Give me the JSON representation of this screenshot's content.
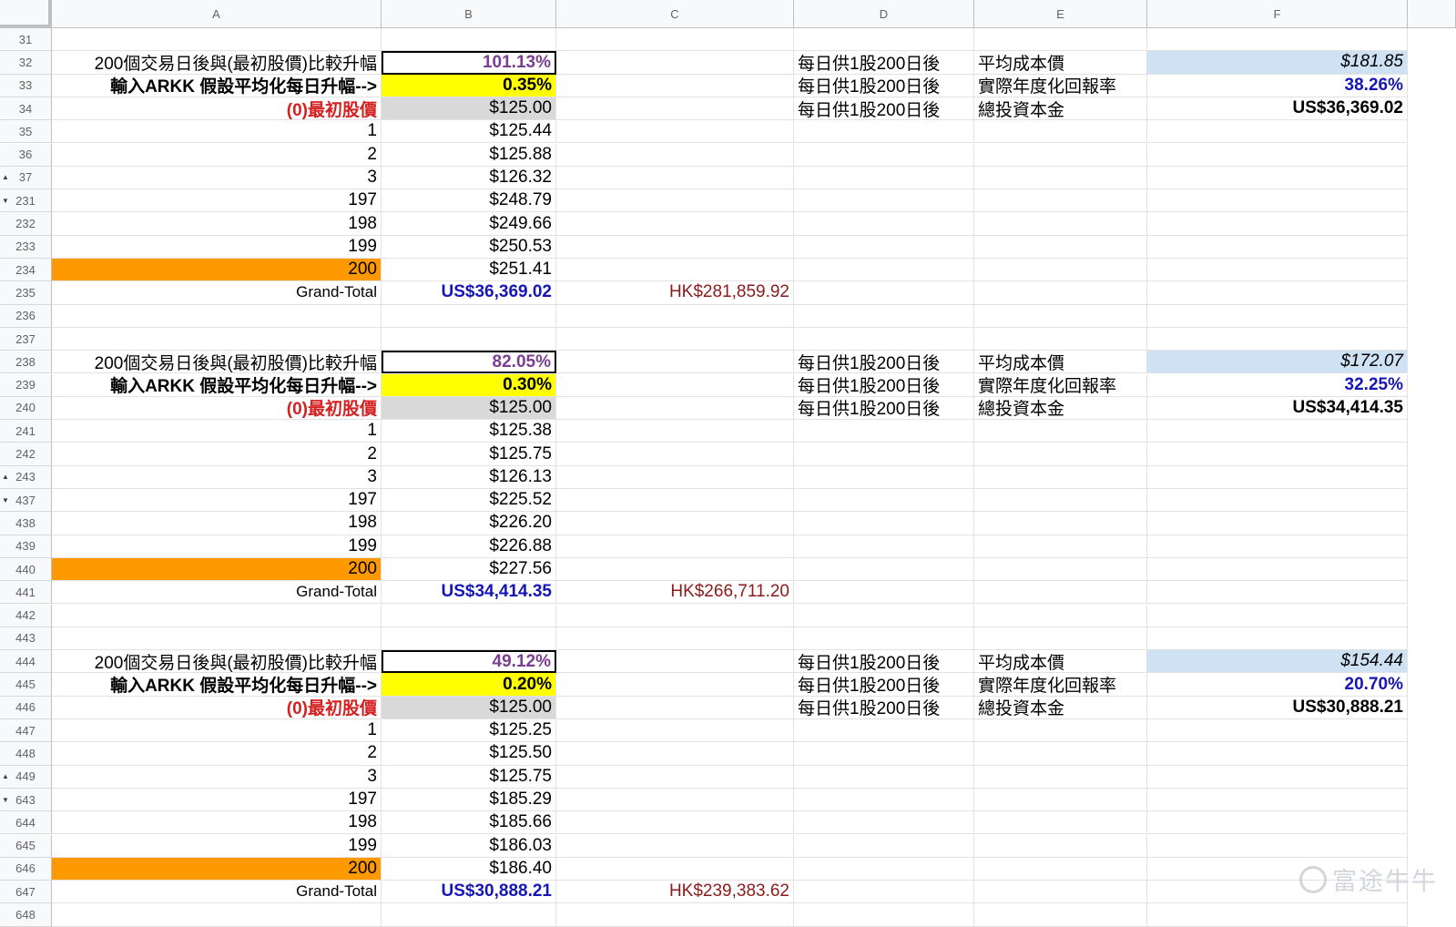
{
  "columns": [
    "A",
    "B",
    "C",
    "D",
    "E",
    "F"
  ],
  "rows": [
    {
      "num": "31",
      "kind": "blank"
    },
    {
      "num": "32",
      "kind": "top",
      "a": "200個交易日後與(最初股價)比較升幅",
      "b": "101.13%",
      "d": "每日供1股200日後",
      "e": "平均成本價",
      "f": "$181.85"
    },
    {
      "num": "33",
      "kind": "input",
      "a": "輸入ARKK 假設平均化每日升幅-->",
      "b": "0.35%",
      "d": "每日供1股200日後",
      "e": "實際年度化回報率",
      "f": "38.26%"
    },
    {
      "num": "34",
      "kind": "initial",
      "a": "(0)最初股價",
      "b": "$125.00",
      "d": "每日供1股200日後",
      "e": "總投資本金",
      "f": "US$36,369.02"
    },
    {
      "num": "35",
      "kind": "day",
      "a": "1",
      "b": "$125.44"
    },
    {
      "num": "36",
      "kind": "day",
      "a": "2",
      "b": "$125.88"
    },
    {
      "num": "37",
      "kind": "day",
      "arrow": "up",
      "a": "3",
      "b": "$126.32"
    },
    {
      "num": "231",
      "kind": "day",
      "arrow": "down",
      "a": "197",
      "b": "$248.79"
    },
    {
      "num": "232",
      "kind": "day",
      "a": "198",
      "b": "$249.66"
    },
    {
      "num": "233",
      "kind": "day",
      "a": "199",
      "b": "$250.53"
    },
    {
      "num": "234",
      "kind": "last",
      "a": "200",
      "b": "$251.41"
    },
    {
      "num": "235",
      "kind": "total",
      "a": "Grand-Total",
      "b": "US$36,369.02",
      "c": "HK$281,859.92"
    },
    {
      "num": "236",
      "kind": "blank"
    },
    {
      "num": "237",
      "kind": "blank"
    },
    {
      "num": "238",
      "kind": "top",
      "a": "200個交易日後與(最初股價)比較升幅",
      "b": "82.05%",
      "d": "每日供1股200日後",
      "e": "平均成本價",
      "f": "$172.07"
    },
    {
      "num": "239",
      "kind": "input",
      "a": "輸入ARKK 假設平均化每日升幅-->",
      "b": "0.30%",
      "d": "每日供1股200日後",
      "e": "實際年度化回報率",
      "f": "32.25%"
    },
    {
      "num": "240",
      "kind": "initial",
      "a": "(0)最初股價",
      "b": "$125.00",
      "d": "每日供1股200日後",
      "e": "總投資本金",
      "f": "US$34,414.35"
    },
    {
      "num": "241",
      "kind": "day",
      "a": "1",
      "b": "$125.38"
    },
    {
      "num": "242",
      "kind": "day",
      "a": "2",
      "b": "$125.75"
    },
    {
      "num": "243",
      "kind": "day",
      "arrow": "up",
      "a": "3",
      "b": "$126.13"
    },
    {
      "num": "437",
      "kind": "day",
      "arrow": "down",
      "a": "197",
      "b": "$225.52"
    },
    {
      "num": "438",
      "kind": "day",
      "a": "198",
      "b": "$226.20"
    },
    {
      "num": "439",
      "kind": "day",
      "a": "199",
      "b": "$226.88"
    },
    {
      "num": "440",
      "kind": "last",
      "a": "200",
      "b": "$227.56"
    },
    {
      "num": "441",
      "kind": "total",
      "a": "Grand-Total",
      "b": "US$34,414.35",
      "c": "HK$266,711.20"
    },
    {
      "num": "442",
      "kind": "blank"
    },
    {
      "num": "443",
      "kind": "blank"
    },
    {
      "num": "444",
      "kind": "top",
      "a": "200個交易日後與(最初股價)比較升幅",
      "b": "49.12%",
      "d": "每日供1股200日後",
      "e": "平均成本價",
      "f": "$154.44"
    },
    {
      "num": "445",
      "kind": "input",
      "a": "輸入ARKK 假設平均化每日升幅-->",
      "b": "0.20%",
      "d": "每日供1股200日後",
      "e": "實際年度化回報率",
      "f": "20.70%"
    },
    {
      "num": "446",
      "kind": "initial",
      "a": "(0)最初股價",
      "b": "$125.00",
      "d": "每日供1股200日後",
      "e": "總投資本金",
      "f": "US$30,888.21"
    },
    {
      "num": "447",
      "kind": "day",
      "a": "1",
      "b": "$125.25"
    },
    {
      "num": "448",
      "kind": "day",
      "a": "2",
      "b": "$125.50"
    },
    {
      "num": "449",
      "kind": "day",
      "arrow": "up",
      "a": "3",
      "b": "$125.75"
    },
    {
      "num": "643",
      "kind": "day",
      "arrow": "down",
      "a": "197",
      "b": "$185.29"
    },
    {
      "num": "644",
      "kind": "day",
      "a": "198",
      "b": "$185.66"
    },
    {
      "num": "645",
      "kind": "day",
      "a": "199",
      "b": "$186.03"
    },
    {
      "num": "646",
      "kind": "last",
      "a": "200",
      "b": "$186.40"
    },
    {
      "num": "647",
      "kind": "total",
      "a": "Grand-Total",
      "b": "US$30,888.21",
      "c": "HK$239,383.62"
    },
    {
      "num": "648",
      "kind": "blank"
    }
  ],
  "watermark": "富途牛牛",
  "colors": {
    "highlight_yellow": "#ffff00",
    "highlight_orange": "#ff9900",
    "highlight_grey": "#d9d9d9",
    "highlight_lightblue": "#cfe2f3",
    "value_blue": "#1515b8",
    "value_purple": "#7a3d91",
    "value_maroon": "#8b1a1a",
    "label_red": "#d62020"
  }
}
